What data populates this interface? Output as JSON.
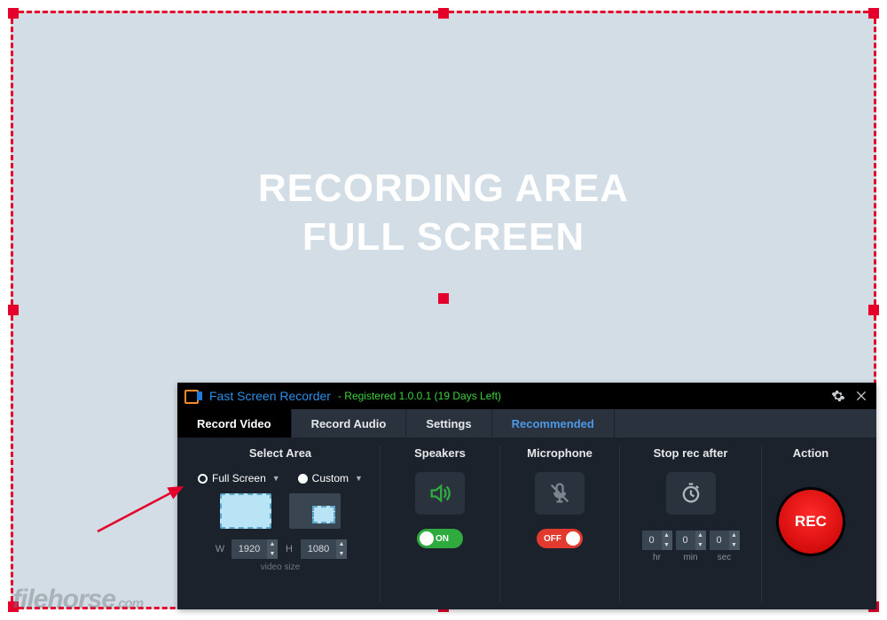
{
  "recording_area": {
    "line1": "RECORDING AREA",
    "line2": "FULL SCREEN"
  },
  "panel": {
    "title": "Fast Screen Recorder",
    "registration": "- Registered 1.0.0.1 (19 Days Left)",
    "tabs": {
      "record_video": "Record Video",
      "record_audio": "Record Audio",
      "settings": "Settings",
      "recommended": "Recommended"
    },
    "columns": {
      "select_area": {
        "header": "Select Area",
        "full_screen": "Full Screen",
        "custom": "Custom",
        "w_label": "W",
        "h_label": "H",
        "width_value": "1920",
        "height_value": "1080",
        "hint": "video size"
      },
      "speakers": {
        "header": "Speakers",
        "toggle": "ON"
      },
      "microphone": {
        "header": "Microphone",
        "toggle": "OFF"
      },
      "stop_after": {
        "header": "Stop rec after",
        "hr_value": "0",
        "min_value": "0",
        "sec_value": "0",
        "hr_label": "hr",
        "min_label": "min",
        "sec_label": "sec"
      },
      "action": {
        "header": "Action",
        "rec_label": "REC"
      }
    }
  },
  "watermark": {
    "brand": "filehorse",
    "tld": ".com"
  }
}
